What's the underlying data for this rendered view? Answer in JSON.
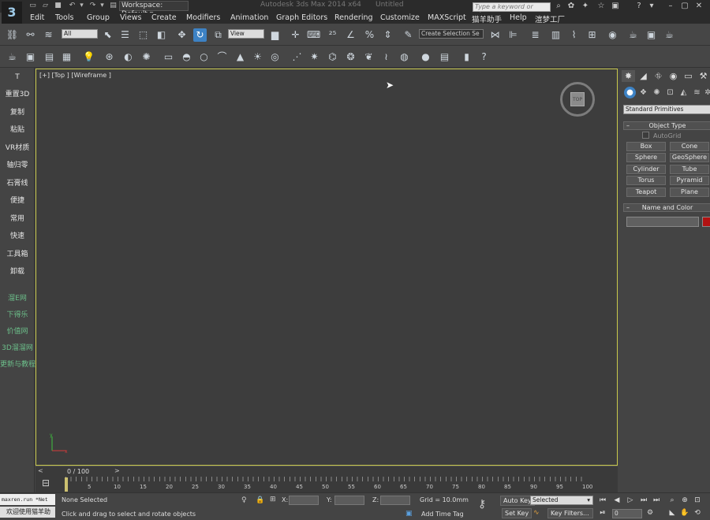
{
  "title_bar": {
    "workspace": "Workspace: Default",
    "app_title": "Autodesk 3ds Max  2014 x64",
    "file_name": "Untitled",
    "search_placeholder": "Type a keyword or phrase"
  },
  "menu": [
    "Edit",
    "Tools",
    "Group",
    "Views",
    "Create",
    "Modifiers",
    "Animation",
    "Graph Editors",
    "Rendering",
    "Customize",
    "MAXScript",
    "猫羊助手",
    "Help",
    "渲梦工厂"
  ],
  "toolbar": {
    "selection_filter": "All",
    "ref_coord": "View",
    "named_selection": "Create Selection Se"
  },
  "left_panel": {
    "top_icon": "T",
    "items": [
      "重置3D",
      "复制",
      "粘贴",
      "VR材质",
      "轴归零",
      "石膏线",
      "便捷",
      "常用",
      "快速",
      "工具箱",
      "卸载"
    ],
    "links": [
      "溜E网",
      "下得乐",
      "价值网",
      "3D溜溜网",
      "更新与教程"
    ]
  },
  "viewport": {
    "label": "[+] [Top ] [Wireframe ]",
    "viewcube_face": "TOP"
  },
  "command_panel": {
    "category": "Standard Primitives",
    "object_type_title": "Object Type",
    "autogrid": "AutoGrid",
    "objects": [
      "Box",
      "Cone",
      "Sphere",
      "GeoSphere",
      "Cylinder",
      "Tube",
      "Torus",
      "Pyramid",
      "Teapot",
      "Plane"
    ],
    "name_color_title": "Name and Color",
    "object_color": "#b21212"
  },
  "timeline": {
    "frame_label": "0 / 100",
    "ticks": [
      "0",
      "5",
      "10",
      "15",
      "20",
      "25",
      "30",
      "35",
      "40",
      "45",
      "50",
      "55",
      "60",
      "65",
      "70",
      "75",
      "80",
      "85",
      "90",
      "95",
      "100"
    ]
  },
  "status_bar": {
    "maxscript_text": "maxren.run *Net",
    "welcome": "欢迎使用猫羊助",
    "selection": "None Selected",
    "prompt": "Click and drag to select and rotate objects",
    "coord_x": "X:",
    "coord_y": "Y:",
    "coord_z": "Z:",
    "grid": "Grid = 10.0mm",
    "add_time_tag": "Add Time Tag",
    "auto_key": "Auto Key",
    "set_key": "Set Key",
    "selected_option": "Selected",
    "key_filters": "Key Filters...",
    "current_frame": "0"
  }
}
